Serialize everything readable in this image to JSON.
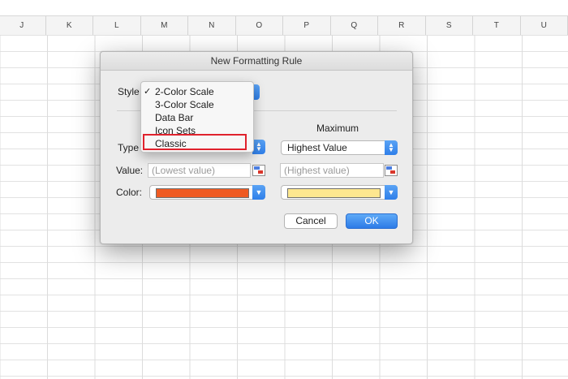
{
  "spreadsheet": {
    "columns": [
      "J",
      "K",
      "L",
      "M",
      "N",
      "O",
      "P",
      "Q",
      "R",
      "S",
      "T",
      "U"
    ]
  },
  "dialog": {
    "title": "New Formatting Rule",
    "style_label": "Style",
    "style_menu": {
      "items": [
        {
          "label": "2-Color Scale",
          "checked": true
        },
        {
          "label": "3-Color Scale",
          "checked": false
        },
        {
          "label": "Data Bar",
          "checked": false
        },
        {
          "label": "Icon Sets",
          "checked": false
        },
        {
          "label": "Classic",
          "checked": false,
          "highlighted": true
        }
      ],
      "check_glyph": "✓"
    },
    "type_label": "Type",
    "value_label": "Value:",
    "color_label": "Color:",
    "maximum_header": "Maximum",
    "maximum_type_value": "Highest Value",
    "minimum_value_placeholder": "(Lowest value)",
    "maximum_value_placeholder": "(Highest value)",
    "minimum_color": "#ef5a22",
    "maximum_color": "#fde78f",
    "cancel_label": "Cancel",
    "ok_label": "OK"
  },
  "colors": {
    "accent": "#2f7fe9",
    "highlight_box": "#e0222d"
  }
}
